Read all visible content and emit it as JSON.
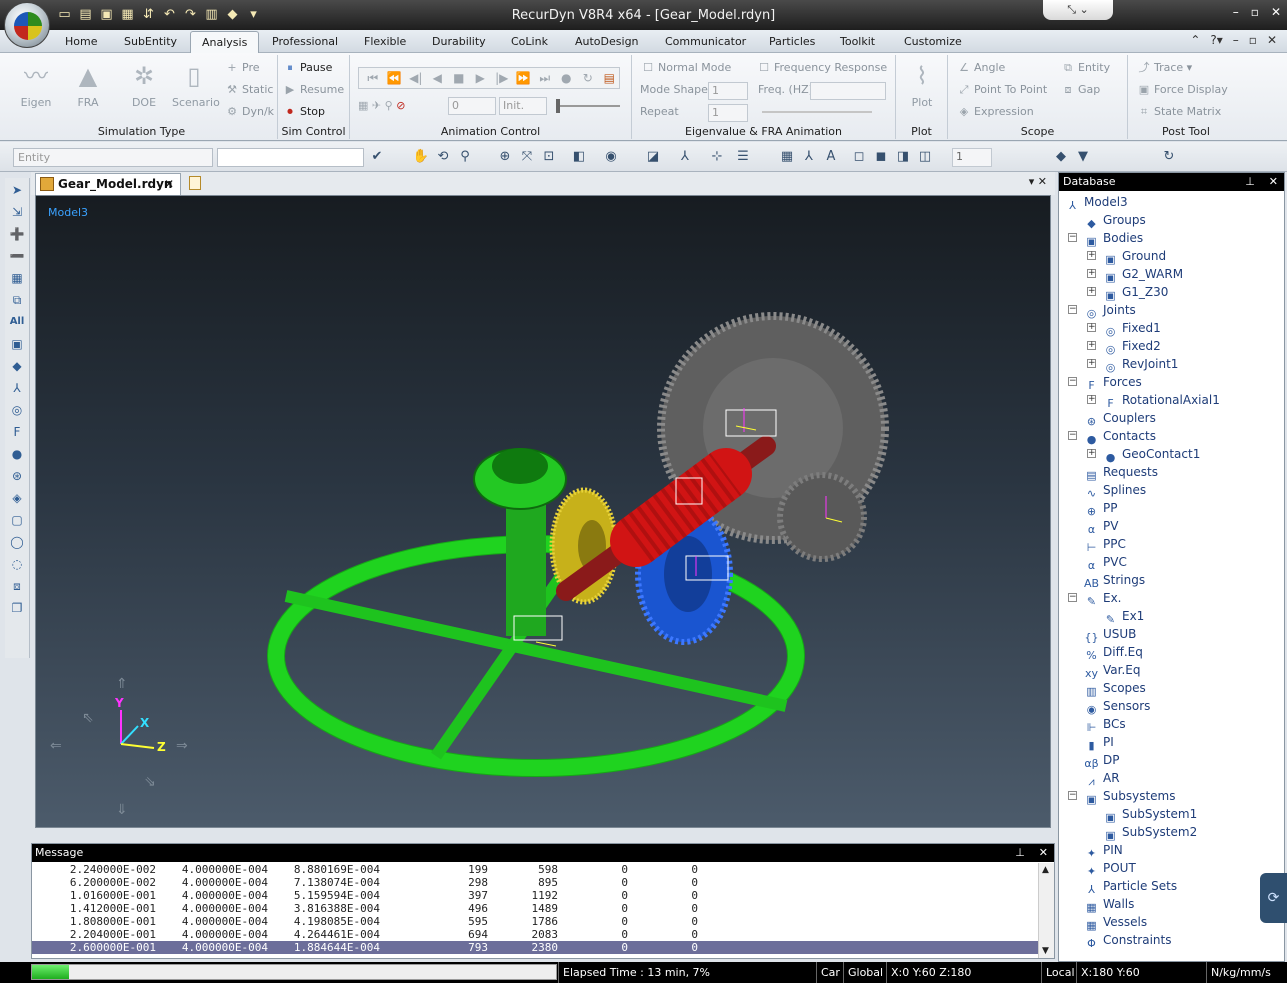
{
  "window": {
    "title": "RecurDyn V8R4 x64 - [Gear_Model.rdyn]",
    "controls": [
      "–",
      "▫",
      "✕"
    ]
  },
  "menu_tabs": [
    "Home",
    "SubEntity",
    "Analysis",
    "Professional",
    "Flexible",
    "Durability",
    "CoLink",
    "AutoDesign",
    "Communicator",
    "Particles",
    "Toolkit",
    "Customize"
  ],
  "ribbon": {
    "simulation_type": {
      "label": "Simulation Type",
      "eigen": "Eigen",
      "fra": "FRA",
      "doe": "DOE",
      "scenario": "Scenario",
      "pre": "Pre",
      "static": "Static",
      "dynk": "Dyn/k"
    },
    "sim_control": {
      "label": "Sim Control",
      "pause": "Pause",
      "resume": "Resume",
      "stop": "Stop"
    },
    "animation_control": {
      "label": "Animation Control",
      "frame_value": "0",
      "init": "Init."
    },
    "eigen_fra": {
      "label": "Eigenvalue & FRA Animation",
      "normal_mode": "Normal Mode",
      "mode_shape": "Mode Shape",
      "mode_shape_value": "1",
      "repeat": "Repeat",
      "repeat_value": "1",
      "frequency_response": "Frequency Response",
      "freq": "Freq. (HZ)"
    },
    "plot": {
      "label": "Plot",
      "plot": "Plot"
    },
    "scope": {
      "label": "Scope",
      "angle": "Angle",
      "point_to_point": "Point To Point",
      "expression": "Expression",
      "entity": "Entity",
      "gap": "Gap"
    },
    "post_tool": {
      "label": "Post Tool",
      "trace": "Trace",
      "force_display": "Force Display",
      "state_matrix": "State Matrix"
    }
  },
  "toolbar2": {
    "entity_placeholder": "Entity",
    "layer_value": "1"
  },
  "document": {
    "tab_label": "Gear_Model.rdyn",
    "model_label": "Model3"
  },
  "view_triad": {
    "x": "X",
    "y": "Y",
    "z": "Z"
  },
  "message_panel": {
    "title": "Message",
    "rows": [
      [
        "2.240000E-002",
        "4.000000E-004",
        "8.880169E-004",
        "199",
        "598",
        "0",
        "0"
      ],
      [
        "6.200000E-002",
        "4.000000E-004",
        "7.138074E-004",
        "298",
        "895",
        "0",
        "0"
      ],
      [
        "1.016000E-001",
        "4.000000E-004",
        "5.159594E-004",
        "397",
        "1192",
        "0",
        "0"
      ],
      [
        "1.412000E-001",
        "4.000000E-004",
        "3.816388E-004",
        "496",
        "1489",
        "0",
        "0"
      ],
      [
        "1.808000E-001",
        "4.000000E-004",
        "4.198085E-004",
        "595",
        "1786",
        "0",
        "0"
      ],
      [
        "2.204000E-001",
        "4.000000E-004",
        "4.264461E-004",
        "694",
        "2083",
        "0",
        "0"
      ],
      [
        "2.600000E-001",
        "4.000000E-004",
        "1.884644E-004",
        "793",
        "2380",
        "0",
        "0"
      ]
    ]
  },
  "database": {
    "title": "Database",
    "items": [
      {
        "label": "Model3",
        "icon": "model-icon"
      },
      {
        "label": "Groups",
        "icon": "groups-icon"
      },
      {
        "label": "Bodies",
        "icon": "bodies-icon"
      },
      {
        "label": "Ground",
        "icon": "body-icon"
      },
      {
        "label": "G2_WARM",
        "icon": "body-icon"
      },
      {
        "label": "G1_Z30",
        "icon": "body-icon"
      },
      {
        "label": "Joints",
        "icon": "joints-icon"
      },
      {
        "label": "Fixed1",
        "icon": "joint-icon"
      },
      {
        "label": "Fixed2",
        "icon": "joint-icon"
      },
      {
        "label": "RevJoint1",
        "icon": "joint-icon"
      },
      {
        "label": "Forces",
        "icon": "forces-icon"
      },
      {
        "label": "RotationalAxial1",
        "icon": "force-icon"
      },
      {
        "label": "Couplers",
        "icon": "couplers-icon"
      },
      {
        "label": "Contacts",
        "icon": "contacts-icon"
      },
      {
        "label": "GeoContact1",
        "icon": "contact-icon"
      },
      {
        "label": "Requests",
        "icon": "requests-icon"
      },
      {
        "label": "Splines",
        "icon": "splines-icon"
      },
      {
        "label": "PP",
        "icon": "pp-icon"
      },
      {
        "label": "PV",
        "icon": "pv-icon"
      },
      {
        "label": "PPC",
        "icon": "ppc-icon"
      },
      {
        "label": "PVC",
        "icon": "pvc-icon"
      },
      {
        "label": "Strings",
        "icon": "strings-icon"
      },
      {
        "label": "Ex.",
        "icon": "ex-icon"
      },
      {
        "label": "Ex1",
        "icon": "ex-item-icon"
      },
      {
        "label": "USUB",
        "icon": "usub-icon"
      },
      {
        "label": "Diff.Eq",
        "icon": "diffeq-icon"
      },
      {
        "label": "Var.Eq",
        "icon": "vareq-icon"
      },
      {
        "label": "Scopes",
        "icon": "scopes-icon"
      },
      {
        "label": "Sensors",
        "icon": "sensors-icon"
      },
      {
        "label": "BCs",
        "icon": "bcs-icon"
      },
      {
        "label": "PI",
        "icon": "pi-icon"
      },
      {
        "label": "DP",
        "icon": "dp-icon"
      },
      {
        "label": "AR",
        "icon": "ar-icon"
      },
      {
        "label": "Subsystems",
        "icon": "subsystems-icon"
      },
      {
        "label": "SubSystem1",
        "icon": "subsystem-icon"
      },
      {
        "label": "SubSystem2",
        "icon": "subsystem-icon"
      },
      {
        "label": "PIN",
        "icon": "pin-icon"
      },
      {
        "label": "POUT",
        "icon": "pout-icon"
      },
      {
        "label": "Particle Sets",
        "icon": "particle-sets-icon"
      },
      {
        "label": "Walls",
        "icon": "walls-icon"
      },
      {
        "label": "Vessels",
        "icon": "vessels-icon"
      },
      {
        "label": "Constraints",
        "icon": "constraints-icon"
      }
    ]
  },
  "status": {
    "progress_fraction": 0.07,
    "elapsed": "Elapsed Time : 13 min, 7%",
    "car": "Car",
    "global": "Global",
    "global_coords": "X:0 Y:60 Z:180",
    "local": "Local",
    "local_coords": "X:180 Y:60",
    "units": "N/kg/mm/s"
  },
  "colors": {
    "accent": "#3aa2ff",
    "viewport_top": "#171c21",
    "viewport_bottom": "#4c5b6b",
    "ring": "#22dd22",
    "worm": "#cc1111",
    "gear_blue": "#1f5fe0",
    "gear_yellow": "#d9c21a",
    "gear_grey": "#6d6d6d"
  }
}
